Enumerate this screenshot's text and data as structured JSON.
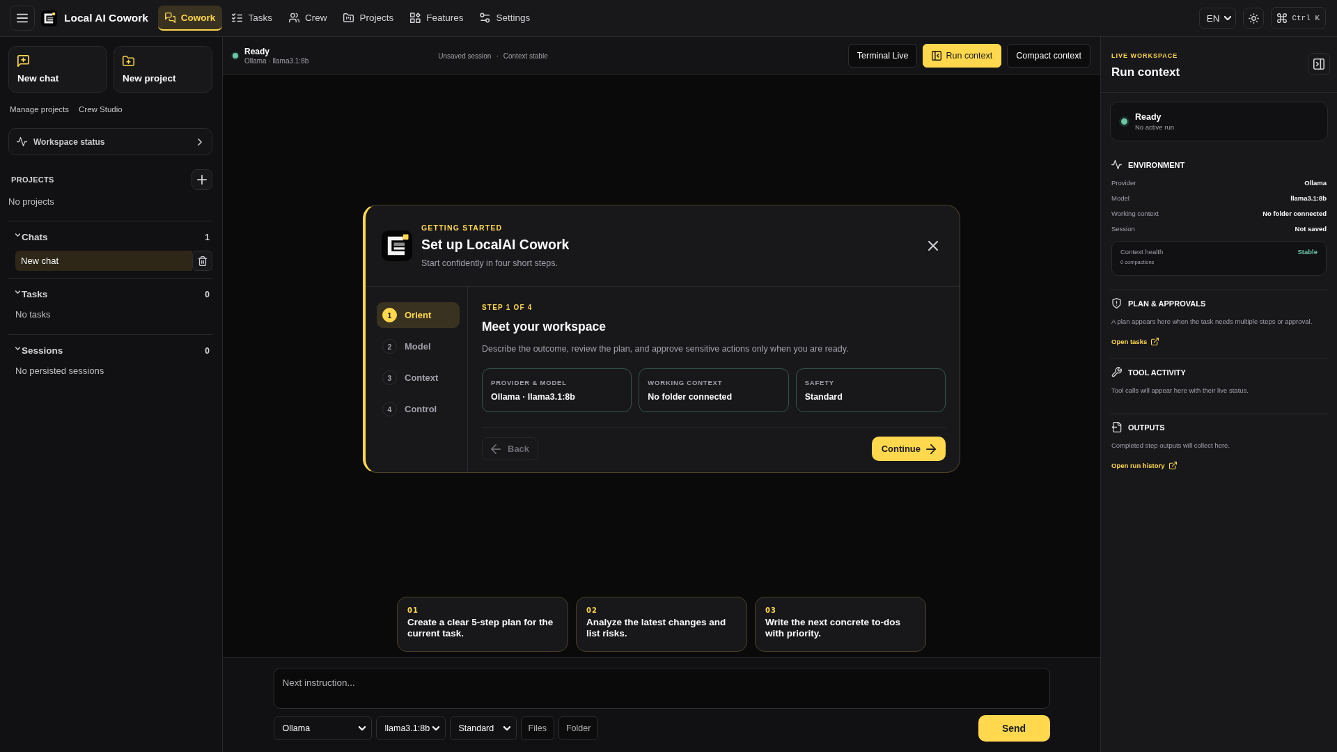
{
  "app": {
    "title": "Local AI Cowork"
  },
  "nav": [
    {
      "label": "Cowork",
      "selected": true
    },
    {
      "label": "Tasks",
      "selected": false
    },
    {
      "label": "Crew",
      "selected": false
    },
    {
      "label": "Projects",
      "selected": false
    },
    {
      "label": "Features",
      "selected": false
    },
    {
      "label": "Settings",
      "selected": false
    }
  ],
  "toolbar": {
    "language": "EN",
    "shortcut": "Ctrl K"
  },
  "sidebar": {
    "actions": [
      {
        "label": "New chat"
      },
      {
        "label": "New project"
      }
    ],
    "links": [
      "Manage projects",
      "Crew Studio"
    ],
    "workspace_status": "Workspace status",
    "projects": {
      "title": "PROJECTS",
      "empty": "No projects"
    },
    "sections": [
      {
        "title": "Chats",
        "count": "1",
        "expanded": true,
        "items": [
          {
            "label": "New chat",
            "selected": true
          }
        ]
      },
      {
        "title": "Tasks",
        "count": "0",
        "expanded": true,
        "empty": "No tasks"
      },
      {
        "title": "Sessions",
        "count": "0",
        "expanded": true,
        "empty": "No persisted sessions"
      }
    ]
  },
  "session_bar": {
    "status": "Ready",
    "model": "Ollama · llama3.1:8b",
    "meta": [
      "Unsaved session",
      "Context stable"
    ],
    "meta_separator": "·",
    "buttons": [
      {
        "label": "Terminal Live",
        "selected": false,
        "with_icon": false
      },
      {
        "label": "Run context",
        "selected": true,
        "with_icon": true
      },
      {
        "label": "Compact context",
        "selected": false,
        "with_icon": false
      }
    ]
  },
  "dialog": {
    "eyebrow": "GETTING STARTED",
    "title": "Set up LocalAI Cowork",
    "subtitle": "Start confidently in four short steps.",
    "steps": [
      {
        "number": "1",
        "label": "Orient",
        "selected": true
      },
      {
        "number": "2",
        "label": "Model",
        "selected": false
      },
      {
        "number": "3",
        "label": "Context",
        "selected": false
      },
      {
        "number": "4",
        "label": "Control",
        "selected": false
      }
    ],
    "step_label": "STEP 1 OF 4",
    "heading": "Meet your workspace",
    "description": "Describe the outcome, review the plan, and approve sensitive actions only when you are ready.",
    "cards": [
      {
        "label": "PROVIDER & MODEL",
        "value": "Ollama · llama3.1:8b"
      },
      {
        "label": "WORKING CONTEXT",
        "value": "No folder connected"
      },
      {
        "label": "SAFETY",
        "value": "Standard"
      }
    ],
    "back": {
      "label": "Back",
      "disabled": true
    },
    "continue": {
      "label": "Continue",
      "disabled": false
    }
  },
  "suggestions": [
    {
      "number": "01",
      "text": "Create a clear 5-step plan for the current task."
    },
    {
      "number": "02",
      "text": "Analyze the latest changes and list risks."
    },
    {
      "number": "03",
      "text": "Write the next concrete to-dos with priority."
    }
  ],
  "composer": {
    "placeholder": "Next instruction...",
    "selects": [
      "Ollama",
      "llama3.1:8b",
      "Standard"
    ],
    "buttons": [
      "Files",
      "Folder"
    ],
    "send": "Send"
  },
  "inspector": {
    "eyebrow": "LIVE WORKSPACE",
    "title": "Run context",
    "status": {
      "title": "Ready",
      "detail": "No active run"
    },
    "environment": {
      "title": "ENVIRONMENT",
      "rows": [
        {
          "label": "Provider",
          "value": "Ollama"
        },
        {
          "label": "Model",
          "value": "llama3.1:8b"
        },
        {
          "label": "Working context",
          "value": "No folder connected"
        },
        {
          "label": "Session",
          "value": "Not saved"
        }
      ],
      "health": {
        "label": "Context health",
        "value": "Stable",
        "detail": "0 compactions"
      }
    },
    "sections": [
      {
        "title": "PLAN & APPROVALS",
        "text": "A plan appears here when the task needs multiple steps or approval.",
        "link": "Open tasks"
      },
      {
        "title": "TOOL ACTIVITY",
        "text": "Tool calls will appear here with their live status."
      },
      {
        "title": "OUTPUTS",
        "text": "Completed step outputs will collect here.",
        "link": "Open run history"
      }
    ]
  }
}
